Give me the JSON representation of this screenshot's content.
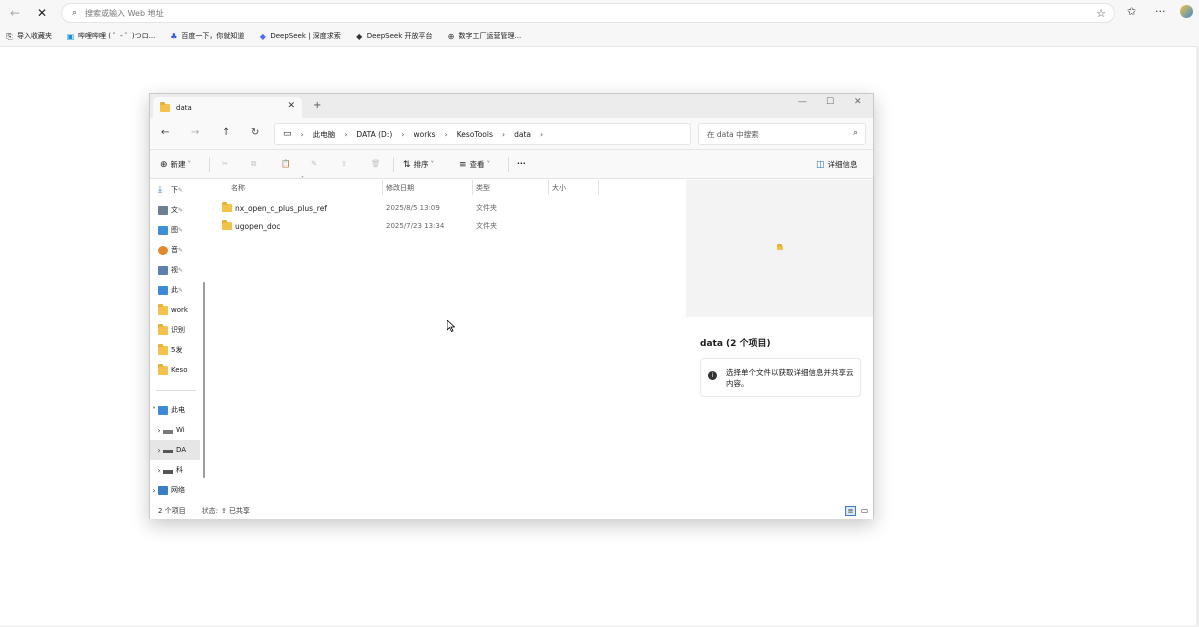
{
  "browser": {
    "address_placeholder": "搜索或输入 Web 地址",
    "bookmarks": [
      {
        "label": "导入收藏夹",
        "icon": "import-icon"
      },
      {
        "label": "哔哩哔哩 ( ゜- ゜)つロ...",
        "icon": "bilibili-icon"
      },
      {
        "label": "百度一下，你就知道",
        "icon": "baidu-icon"
      },
      {
        "label": "DeepSeek | 深度求索",
        "icon": "deepseek-icon"
      },
      {
        "label": "DeepSeek 开放平台",
        "icon": "deepseek-icon"
      },
      {
        "label": "数字工厂运营管理...",
        "icon": "globe-icon"
      }
    ]
  },
  "explorer": {
    "tab_title": "data",
    "breadcrumb": [
      "此电脑",
      "DATA (D:)",
      "works",
      "KesoTools",
      "data"
    ],
    "search_placeholder": "在 data 中搜索",
    "commands": {
      "new": "新建",
      "sort": "排序",
      "view": "查看",
      "more": "···",
      "details": "详细信息"
    },
    "nav_items": [
      {
        "label": "下",
        "icon": "download-icon"
      },
      {
        "label": "文",
        "icon": "document-icon"
      },
      {
        "label": "图",
        "icon": "picture-icon"
      },
      {
        "label": "音",
        "icon": "music-icon"
      },
      {
        "label": "视",
        "icon": "video-icon"
      },
      {
        "label": "此",
        "icon": "pc-icon"
      },
      {
        "label": "work",
        "icon": "folder-icon"
      },
      {
        "label": "识别",
        "icon": "folder-icon"
      },
      {
        "label": "5发",
        "icon": "folder-icon"
      },
      {
        "label": "Keso",
        "icon": "folder-icon"
      },
      {
        "label": "此电",
        "icon": "pc-icon"
      },
      {
        "label": "Wi",
        "icon": "drive-icon"
      },
      {
        "label": "DA",
        "icon": "drive-icon"
      },
      {
        "label": "科",
        "icon": "drive-icon"
      },
      {
        "label": "网络",
        "icon": "network-icon"
      }
    ],
    "columns": [
      "名称",
      "修改日期",
      "类型",
      "大小"
    ],
    "files": [
      {
        "name": "nx_open_c_plus_plus_ref",
        "modified": "2025/8/5 13:09",
        "type": "文件夹"
      },
      {
        "name": "ugopen_doc",
        "modified": "2025/7/23 13:34",
        "type": "文件夹"
      }
    ],
    "details_title": "data (2 个项目)",
    "details_info": "选择单个文件以获取详细信息并共享云内容。",
    "status_count": "2 个项目",
    "status_state_label": "状态:",
    "status_share": "已共享"
  }
}
